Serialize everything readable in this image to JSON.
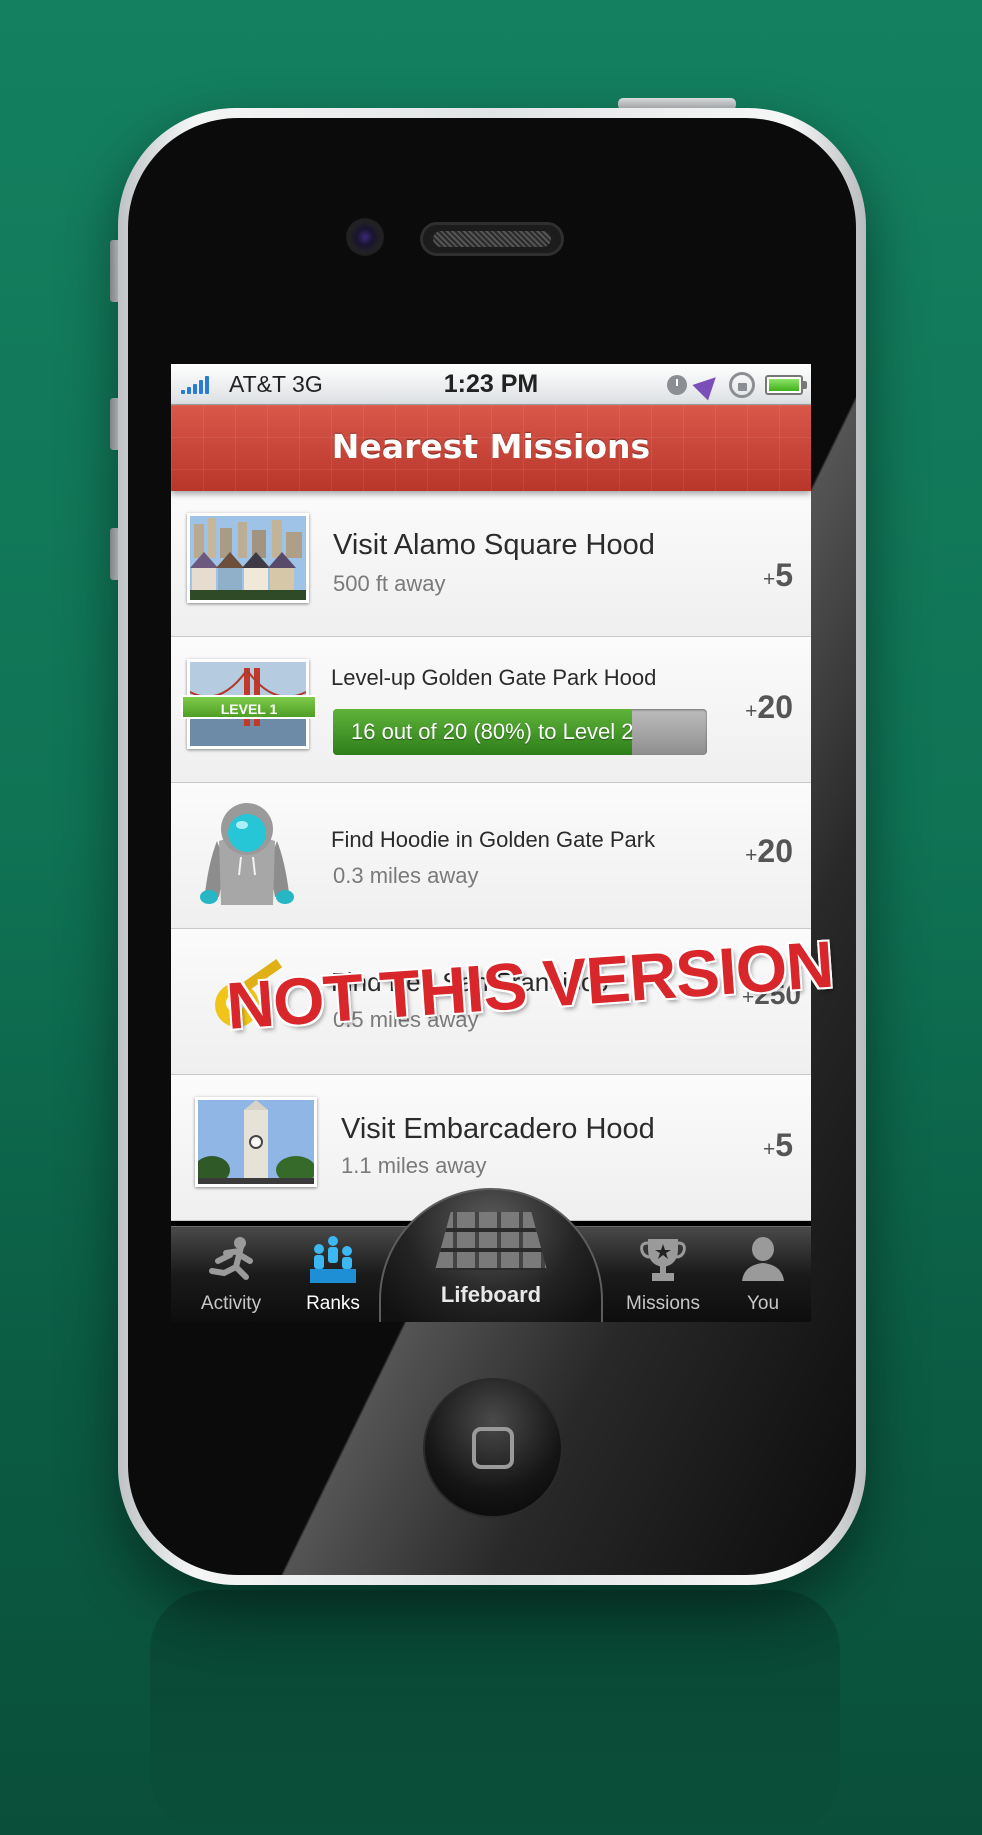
{
  "status": {
    "carrier": "AT&T 3G",
    "time": "1:23 PM"
  },
  "header": {
    "title": "Nearest Missions"
  },
  "missions": [
    {
      "title": "Visit Alamo Square Hood",
      "subtitle": "500 ft away",
      "points": "5",
      "thumb": "painted-ladies-photo"
    },
    {
      "title": "Level-up Golden Gate Park Hood",
      "badge": "LEVEL 1",
      "progress_text": "16 out of 20 (80%) to Level 2",
      "progress": 0.8,
      "points": "20",
      "thumb": "golden-gate-bridge-photo"
    },
    {
      "title": "Find Hoodie in Golden Gate Park",
      "subtitle": "0.3 miles away",
      "points": "20",
      "thumb": "hoodie-icon"
    },
    {
      "title": "Find Ke...San Francisco",
      "subtitle": "0.5 miles away",
      "points": "250",
      "thumb": "key-icon"
    },
    {
      "title": "Visit Embarcadero Hood",
      "subtitle": "1.1 miles away",
      "points": "5",
      "thumb": "ferry-building-photo"
    }
  ],
  "points_prefix": "+",
  "watermark": "NOT THIS VERSION",
  "tabs": [
    {
      "label": "Activity",
      "icon": "runner-icon"
    },
    {
      "label": "Ranks",
      "icon": "podium-icon",
      "active": true
    },
    {
      "label": "Lifeboard",
      "icon": "grid-icon"
    },
    {
      "label": "Missions",
      "icon": "trophy-icon"
    },
    {
      "label": "You",
      "icon": "person-icon"
    }
  ],
  "colors": {
    "background": "#0f7354",
    "navbar": "#c13f32",
    "progress": "#3f9a26",
    "active_tab": "#2aa8ea"
  }
}
